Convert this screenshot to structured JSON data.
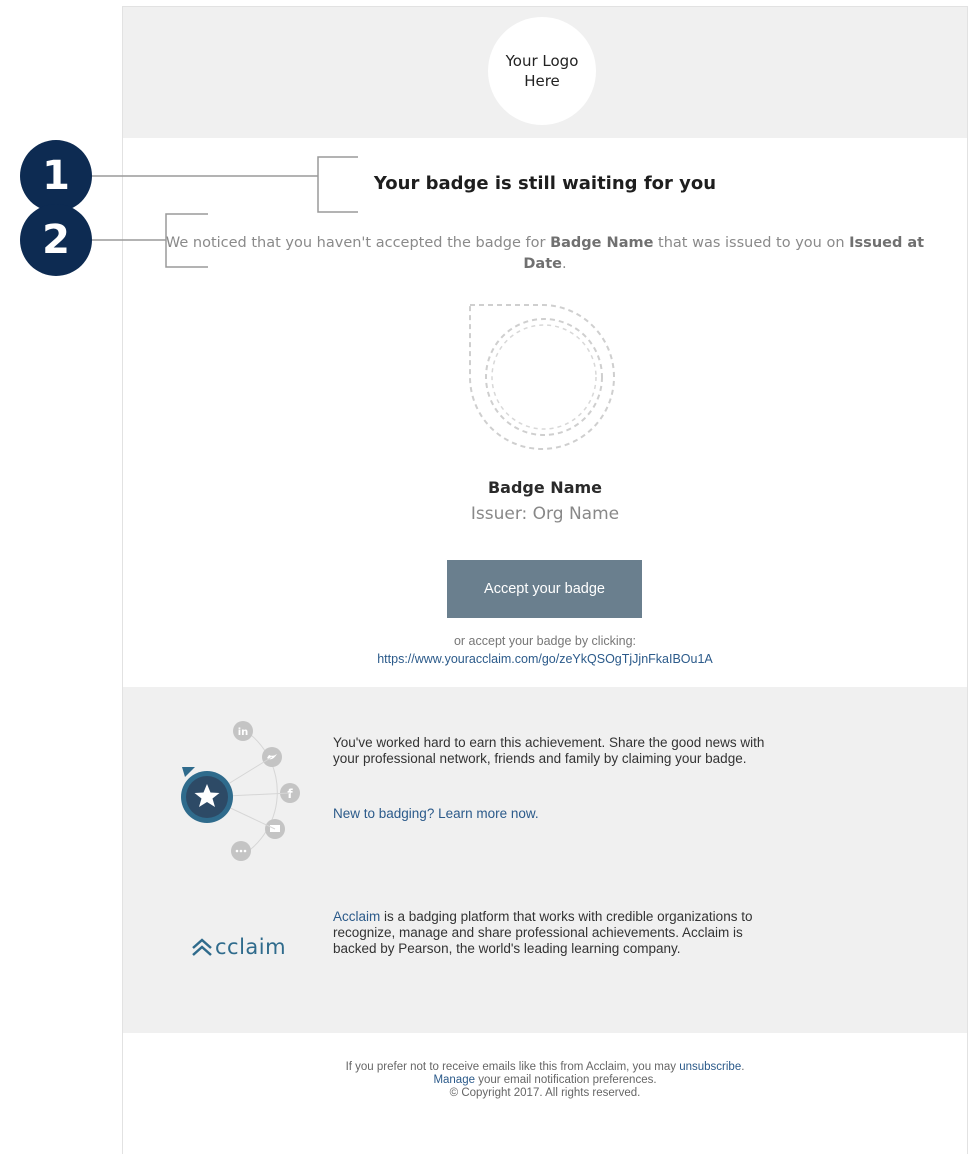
{
  "header": {
    "logo_line1": "Your Logo",
    "logo_line2": "Here"
  },
  "main": {
    "title": "Your badge is still waiting for you",
    "intro_part1": "We noticed that you haven't accepted the badge for ",
    "badge_name_inline": "Badge Name",
    "intro_part2": " that was issued to you on ",
    "issued_date": "Issued at Date",
    "intro_end": ".",
    "badge_name": "Badge Name",
    "issuer": "Issuer: Org Name",
    "accept_button": "Accept your badge",
    "alt_text": "or accept your badge by clicking:",
    "alt_link": "https://www.youracclaim.com/go/zeYkQSOgTjJjnFkaIBOu1A"
  },
  "share": {
    "text": "You've worked hard to earn this achievement. Share the good news with your professional network, friends and family by claiming your badge.",
    "learn_link": "New to badging? Learn more now.",
    "icons": [
      "linkedin-icon",
      "twitter-icon",
      "facebook-icon",
      "email-icon",
      "more-icon",
      "star-icon"
    ]
  },
  "acclaim": {
    "logo_text": "cclaim",
    "link_word": "Acclaim",
    "text": " is a badging platform that works with credible organizations to recognize, manage and share professional achievements. Acclaim is backed by Pearson, the world's leading learning company."
  },
  "footer": {
    "line1_text": "If you prefer not to receive emails like this from Acclaim, you may ",
    "unsubscribe": "unsubscribe",
    "line1_end": ".",
    "manage": "Manage",
    "line2_text": " your email notification preferences.",
    "copyright": "© Copyright 2017. All rights reserved."
  },
  "callouts": [
    "1",
    "2"
  ],
  "colors": {
    "callout": "#0d2b52",
    "button": "#6a7f8e",
    "link": "#2b5a8a",
    "section_bg": "#f0f0f0"
  }
}
